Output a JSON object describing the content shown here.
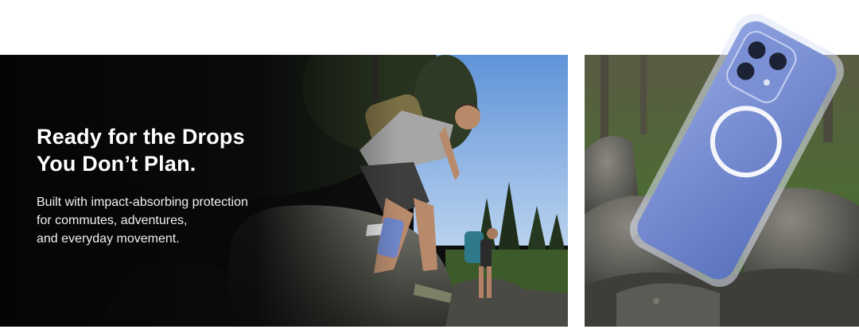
{
  "hero": {
    "headline_line1": "Ready for the Drops",
    "headline_line2": "You Don’t Plan.",
    "body_line1": "Built with impact-absorbing protection",
    "body_line2": "for commutes, adventures,",
    "body_line3": "and everyday movement."
  },
  "images": {
    "left_photo": "hiker-climbing-rocks-with-phone",
    "right_photo": "phone-case-dropping-on-rocks"
  },
  "colors": {
    "text": "#ffffff",
    "background": "#ffffff",
    "left_panel_dark": "#0b0b0b",
    "phone_blue": "#6f86c9"
  }
}
